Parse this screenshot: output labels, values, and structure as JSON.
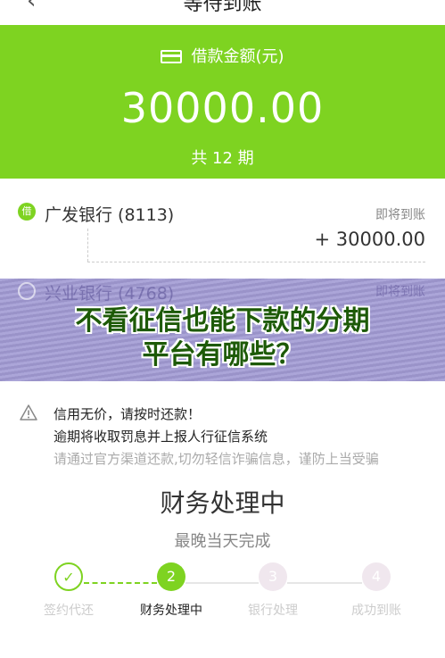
{
  "header": {
    "title": "等待到账",
    "back_icon": "chevron-left-icon"
  },
  "loan": {
    "amount_label": "借款金额(元)",
    "amount": "30000.00",
    "periods": "共 12 期",
    "accent_color": "#7ed321"
  },
  "banks": [
    {
      "badge": "借",
      "name": "广发银行 (8113)",
      "status": "即将到账",
      "amount": "+ 30000.00"
    },
    {
      "badge": "还",
      "name": "兴业银行 (4768)",
      "status": "即将到账"
    }
  ],
  "overlay": {
    "line1": "不看征信也能下款的分期",
    "line2": "平台有哪些？"
  },
  "notice": {
    "line1": "信用无价，请按时还款！",
    "line2": "逾期将收取罚息并上报人行征信系统",
    "line3": "请通过官方渠道还款,切勿轻信诈骗信息，谨防上当受骗"
  },
  "status": {
    "title": "财务处理中",
    "subtitle": "最晚当天完成"
  },
  "steps": [
    {
      "number": "1",
      "label": "签约代还",
      "state": "done"
    },
    {
      "number": "2",
      "label": "财务处理中",
      "state": "active"
    },
    {
      "number": "3",
      "label": "银行处理",
      "state": "todo"
    },
    {
      "number": "4",
      "label": "成功到账",
      "state": "todo"
    }
  ]
}
